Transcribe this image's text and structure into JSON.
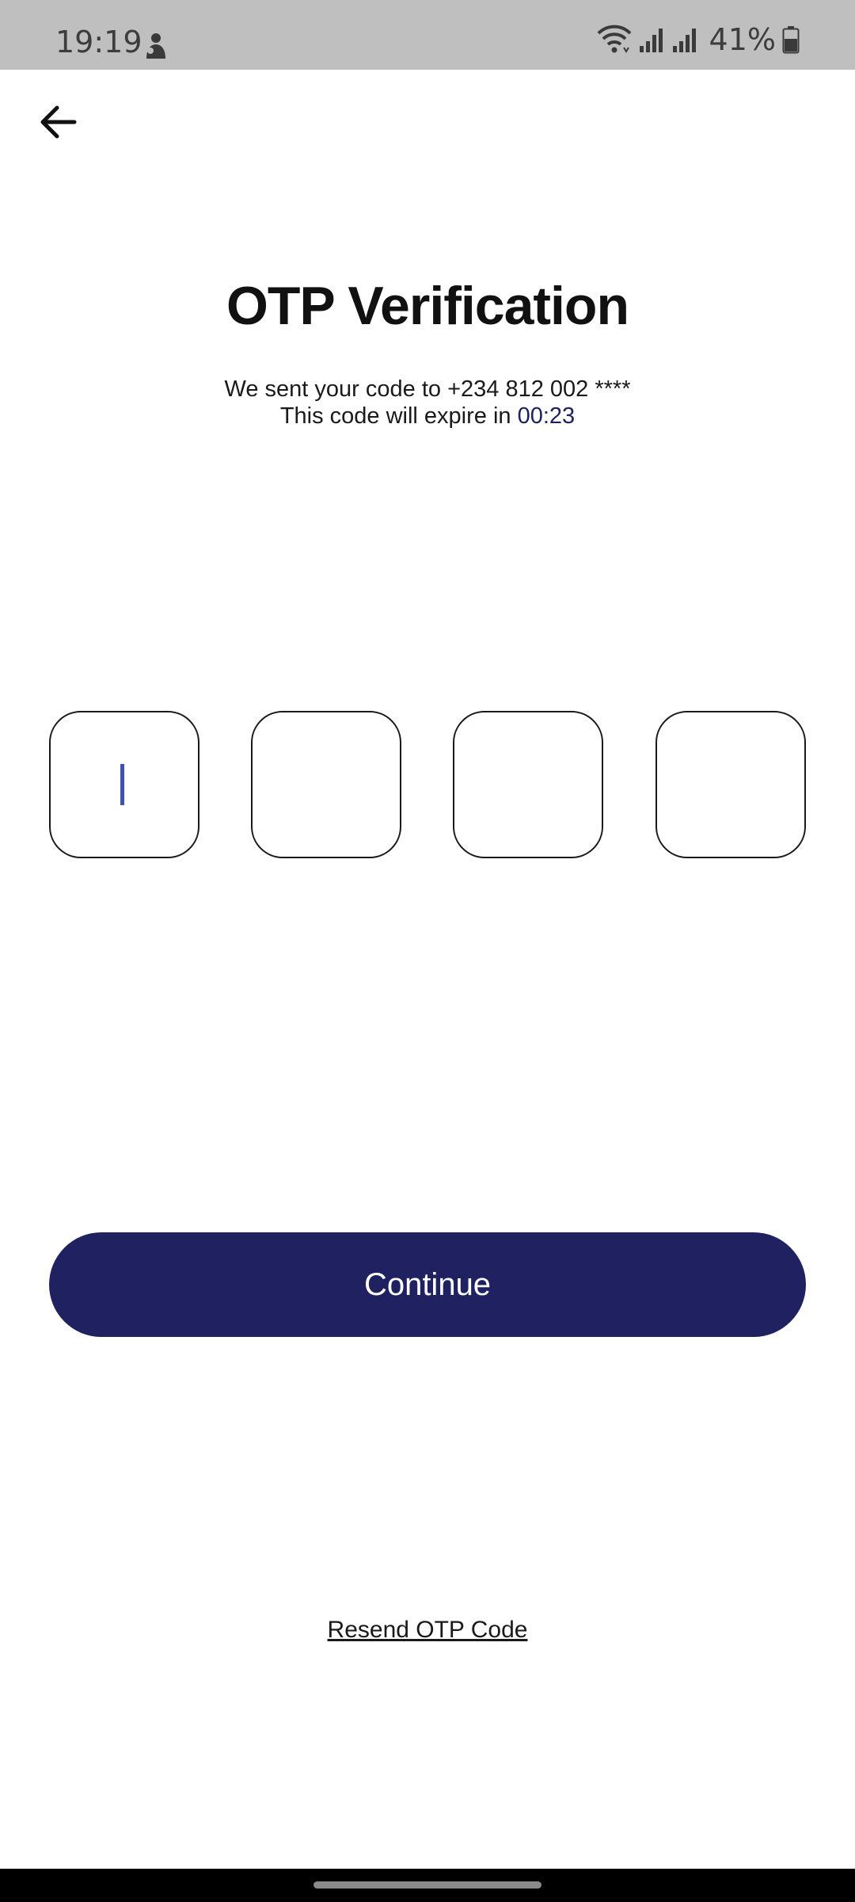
{
  "status_bar": {
    "time": "19:19",
    "battery": "41%",
    "icons": [
      "person-icon",
      "wifi-icon",
      "signal-icon",
      "signal-icon",
      "battery-icon"
    ]
  },
  "header": {
    "back_icon": "arrow-left-icon"
  },
  "main": {
    "title": "OTP Verification",
    "sent_text": "We sent your code to +234 812 002 ****",
    "expire_prefix": "This code will expire in ",
    "timer": "00:23",
    "otp_digits": [
      "",
      "",
      "",
      ""
    ]
  },
  "actions": {
    "continue_label": "Continue",
    "resend_label": "Resend OTP Code"
  },
  "colors": {
    "primary": "#1f2160",
    "cursor": "#3f51b5",
    "status_bar": "#bfbfbf"
  }
}
